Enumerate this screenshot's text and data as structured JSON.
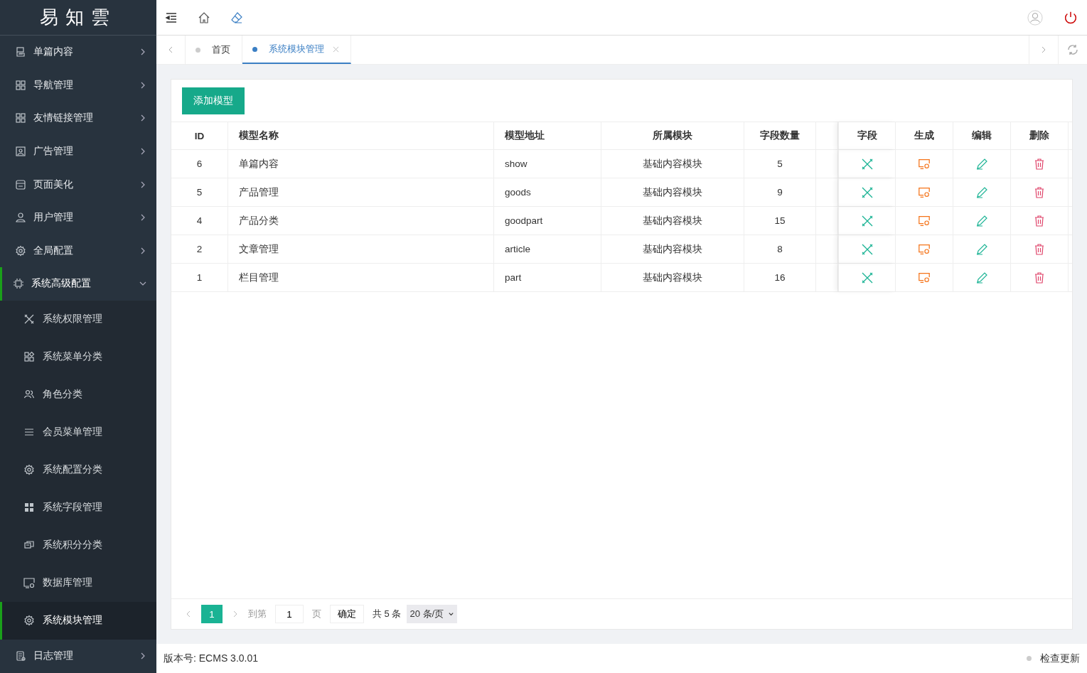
{
  "logo": "易知雲",
  "menu": [
    {
      "label": "单篇内容",
      "expanded": false
    },
    {
      "label": "导航管理",
      "expanded": false
    },
    {
      "label": "友情链接管理",
      "expanded": false
    },
    {
      "label": "广告管理",
      "expanded": false
    },
    {
      "label": "页面美化",
      "expanded": false
    },
    {
      "label": "用户管理",
      "expanded": false
    },
    {
      "label": "全局配置",
      "expanded": false
    },
    {
      "label": "系统高级配置",
      "expanded": true,
      "children": [
        {
          "label": "系统权限管理",
          "selected": false
        },
        {
          "label": "系统菜单分类",
          "selected": false
        },
        {
          "label": "角色分类",
          "selected": false
        },
        {
          "label": "会员菜单管理",
          "selected": false
        },
        {
          "label": "系统配置分类",
          "selected": false
        },
        {
          "label": "系统字段管理",
          "selected": false
        },
        {
          "label": "系统积分分类",
          "selected": false
        },
        {
          "label": "数据库管理",
          "selected": false
        },
        {
          "label": "系统模块管理",
          "selected": true
        }
      ]
    },
    {
      "label": "日志管理",
      "expanded": false
    }
  ],
  "tabs": [
    {
      "label": "首页",
      "selected": false,
      "closable": false
    },
    {
      "label": "系统模块管理",
      "selected": true,
      "closable": true
    }
  ],
  "add_button": "添加模型",
  "table": {
    "columns": [
      "ID",
      "模型名称",
      "模型地址",
      "所属模块",
      "字段数量"
    ],
    "action_columns": [
      "字段",
      "生成",
      "编辑",
      "删除"
    ],
    "rows": [
      [
        "6",
        "单篇内容",
        "show",
        "基础内容模块",
        "5"
      ],
      [
        "5",
        "产品管理",
        "goods",
        "基础内容模块",
        "9"
      ],
      [
        "4",
        "产品分类",
        "goodpart",
        "基础内容模块",
        "15"
      ],
      [
        "2",
        "文章管理",
        "article",
        "基础内容模块",
        "8"
      ],
      [
        "1",
        "栏目管理",
        "part",
        "基础内容模块",
        "16"
      ]
    ]
  },
  "pagination": {
    "pages": [
      {
        "label": "1",
        "selected": true
      }
    ],
    "goto_label": "到第",
    "goto_value": "1",
    "page_unit": "页",
    "confirm": "确定",
    "total": "共 5 条",
    "page_size": "20 条/页"
  },
  "footer": {
    "version": "版本号: ECMS 3.0.01",
    "update_link": "检查更新"
  }
}
